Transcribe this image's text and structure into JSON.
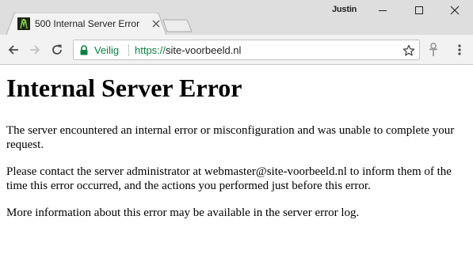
{
  "window": {
    "profile_name": "Justin"
  },
  "tab": {
    "title": "500 Internal Server Error",
    "favicon": "site-favicon"
  },
  "toolbar": {
    "secure_label": "Veilig",
    "url_scheme": "https://",
    "url_host": "site-voorbeeld.nl"
  },
  "page": {
    "heading": "Internal Server Error",
    "paragraphs": [
      "The server encountered an internal error or misconfiguration and was unable to complete your request.",
      "Please contact the server administrator at webmaster@site-voorbeeld.nl to inform them of the time this error occurred, and the actions you performed just before this error.",
      "More information about this error may be available in the server error log."
    ]
  },
  "colors": {
    "secure_green": "#0b8043",
    "titlebar_bg": "#dedede",
    "toolbar_bg": "#f2f2f2"
  }
}
